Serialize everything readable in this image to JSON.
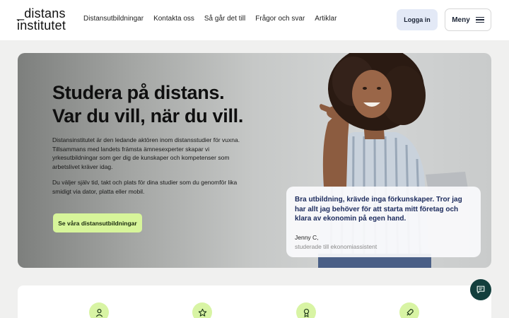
{
  "header": {
    "logo_line1": "_distans",
    "logo_line2": "institutet",
    "nav": [
      "Distansutbildningar",
      "Kontakta oss",
      "Så går det till",
      "Frågor och svar",
      "Artiklar"
    ],
    "login_label": "Logga in",
    "menu_label": "Meny"
  },
  "hero": {
    "title_line1": "Studera på distans.",
    "title_line2": "Var du vill, när du vill.",
    "paragraph1": "Distansinstitutet är den ledande aktören inom distansstudier för vuxna. Tillsammans med landets främsta ämnesexperter skapar vi yrkesutbildningar som ger dig de kunskaper och kompetenser som arbetslivet kräver idag.",
    "paragraph2": "Du väljer själv tid, takt och plats för dina studier som du genomför lika smidigt via dator, platta eller mobil.",
    "cta_label": "Se våra distansutbildningar"
  },
  "testimonial": {
    "quote": "Bra utbildning, krävde inga förkunskaper. Tror jag har allt jag behöver för att starta mitt företag och klara av ekonomin på egen hand.",
    "name": "Jenny C,",
    "role": "studerade till ekonomiassistent"
  },
  "features": {
    "icons": [
      "person-icon",
      "star-icon",
      "medal-icon",
      "rocket-icon"
    ]
  },
  "colors": {
    "accent_green": "#d7f59a",
    "login_bg": "#e3e9f6",
    "chat_bg": "#133f3d",
    "quote_text": "#1b2a5c"
  }
}
